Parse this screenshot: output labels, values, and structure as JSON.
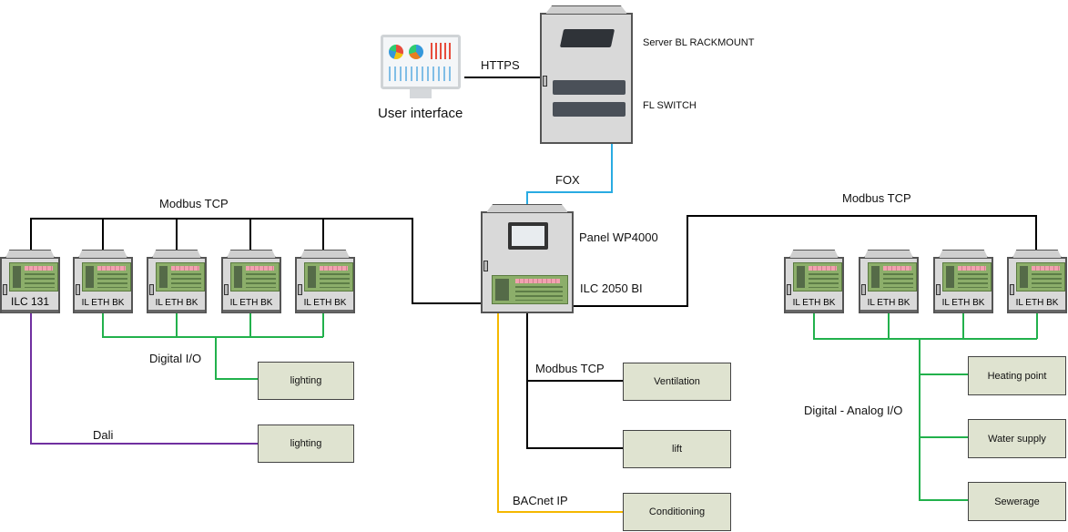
{
  "nodes": {
    "user_interface": "User interface",
    "server": "Server BL RACKMOUNT",
    "switch": "FL SWITCH",
    "panel": "Panel WP4000",
    "ilc2050": "ILC 2050 BI",
    "ilc131": "ILC 131",
    "left_bk": [
      "IL ETH BK",
      "IL ETH BK",
      "IL ETH BK",
      "IL ETH BK"
    ],
    "right_bk": [
      "IL ETH BK",
      "IL ETH BK",
      "IL ETH BK",
      "IL ETH BK"
    ]
  },
  "links": {
    "https": "HTTPS",
    "fox": "FOX",
    "modbus_left": "Modbus TCP",
    "modbus_right": "Modbus TCP",
    "modbus_center": "Modbus TCP",
    "digital_io": "Digital I/O",
    "dali": "Dali",
    "bacnet": "BACnet IP",
    "digital_analog": "Digital - Analog I/O"
  },
  "targets": {
    "lighting_1": "lighting",
    "lighting_2": "lighting",
    "ventilation": "Ventilation",
    "lift": "lift",
    "conditioning": "Conditioning",
    "heating": "Heating point",
    "water": "Water supply",
    "sewerage": "Sewerage"
  },
  "colors": {
    "modbus": "#000000",
    "fox": "#29abe2",
    "digital_io": "#22b14c",
    "dali": "#7030a0",
    "bacnet": "#f5b800"
  }
}
